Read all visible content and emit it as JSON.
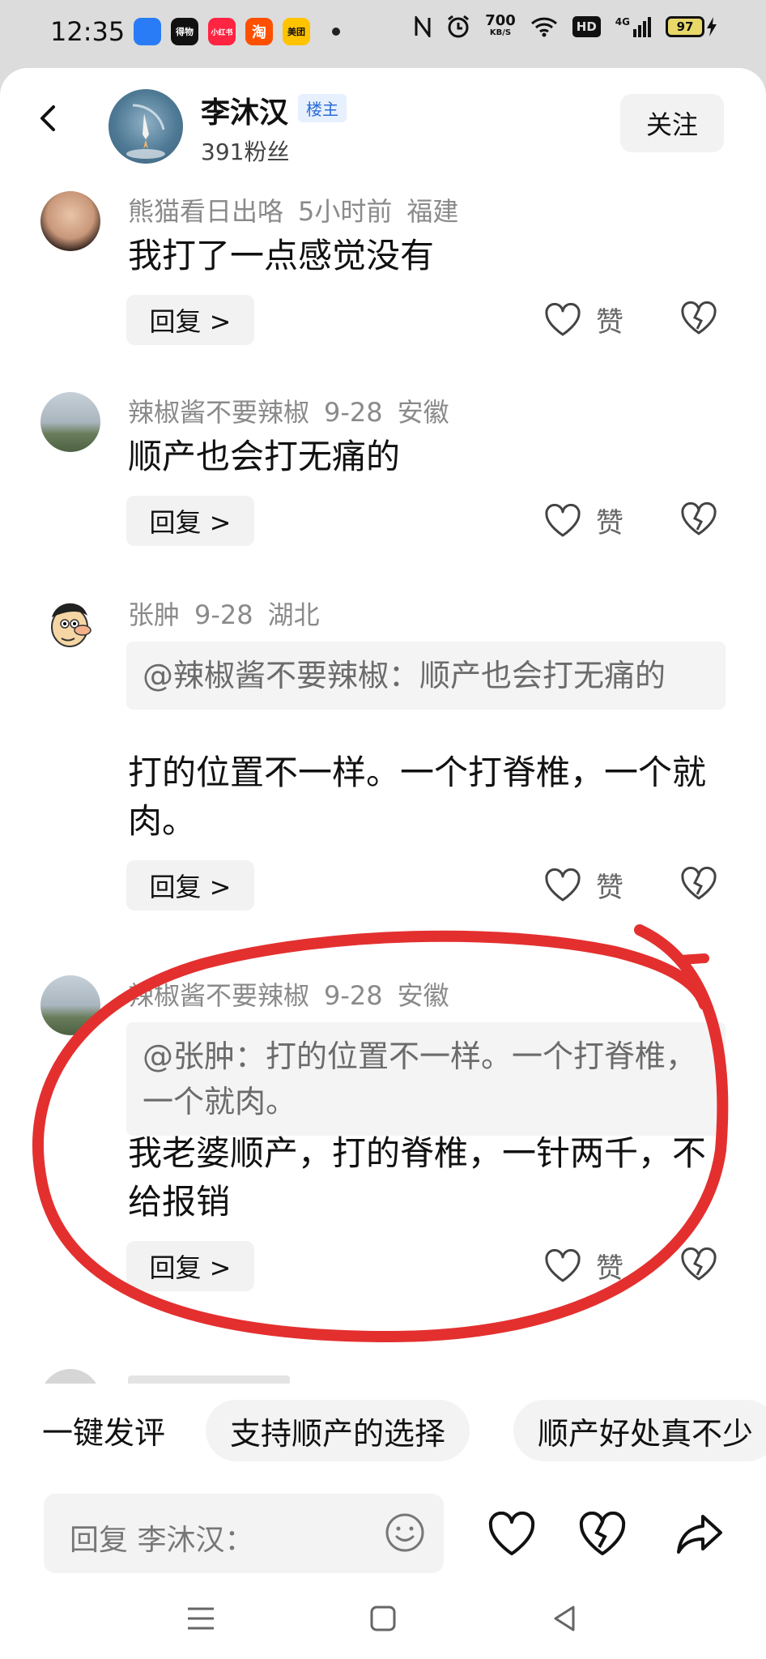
{
  "status_bar": {
    "time": "12:35",
    "apps": [
      {
        "name": "app-1",
        "label": "",
        "color": "#2a7cf6"
      },
      {
        "name": "dewu-app",
        "label": "得物",
        "color": "#111111"
      },
      {
        "name": "xiaohongshu-app",
        "label": "小红书",
        "color": "#ff2442"
      },
      {
        "name": "taobao-app",
        "label": "淘",
        "color": "#ff5000"
      },
      {
        "name": "meituan-app",
        "label": "美团",
        "color": "#ffc300"
      }
    ],
    "speed_value": "700",
    "speed_unit": "KB/S",
    "hd": "HD",
    "network": "4G",
    "battery": "97"
  },
  "header": {
    "host_name": "李沐汉",
    "badge": "楼主",
    "fans": "391粉丝",
    "follow_label": "关注"
  },
  "comments": [
    {
      "author": "熊猫看日出咯",
      "time": "5小时前",
      "location": "福建",
      "quote": "",
      "text": "我打了一点感觉没有",
      "reply_label": "回复 >",
      "like_label": "赞"
    },
    {
      "author": "辣椒酱不要辣椒",
      "time": "9-28",
      "location": "安徽",
      "quote": "",
      "text": "顺产也会打无痛的",
      "reply_label": "回复 >",
      "like_label": "赞"
    },
    {
      "author": "张肿",
      "time": "9-28",
      "location": "湖北",
      "quote": "@辣椒酱不要辣椒：顺产也会打无痛的",
      "text": "打的位置不一样。一个打脊椎，一个就肉。",
      "reply_label": "回复 >",
      "like_label": "赞"
    },
    {
      "author": "辣椒酱不要辣椒",
      "time": "9-28",
      "location": "安徽",
      "quote": "@张肿：打的位置不一样。一个打脊椎，一个就肉。",
      "text": "我老婆顺产，打的脊椎，一针两千，不给报销",
      "reply_label": "回复 >",
      "like_label": "赞"
    }
  ],
  "quick_replies": {
    "lead": "一键发评",
    "chips": [
      "支持顺产的选择",
      "顺产好处真不少"
    ]
  },
  "reply_box": {
    "placeholder": "回复 李沐汉："
  },
  "colors": {
    "annotation_circle": "#e3302f",
    "badge_blue": "#2d6bd6"
  }
}
